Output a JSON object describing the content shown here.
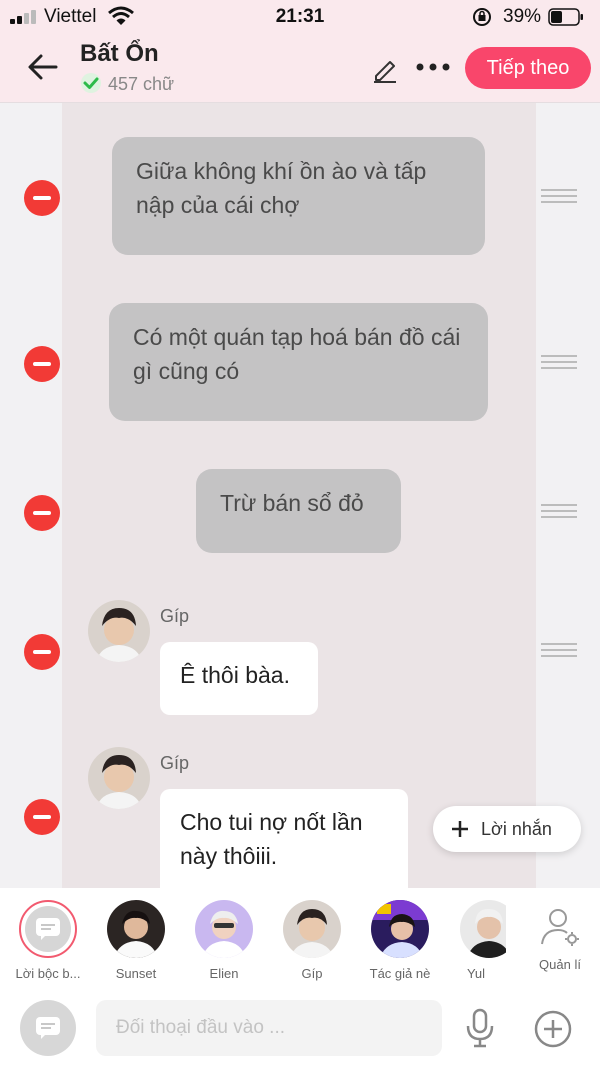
{
  "status_bar": {
    "carrier": "Viettel",
    "time": "21:31",
    "battery": "39%"
  },
  "header": {
    "title": "Bất Ổn",
    "word_count": "457 chữ",
    "next_label": "Tiếp theo"
  },
  "messages": [
    {
      "type": "narration",
      "text": "Giữa không khí ồn ào và tấp nập của cái chợ"
    },
    {
      "type": "narration",
      "text": "Có một quán tạp hoá bán đồ cái gì cũng có"
    },
    {
      "type": "narration",
      "text": "Trừ bán sổ đỏ"
    },
    {
      "type": "dialogue",
      "speaker": "Gíp",
      "text": "Ê thôi bàa."
    },
    {
      "type": "dialogue",
      "speaker": "Gíp",
      "text": "Cho tui nợ nốt lần này thôiii."
    }
  ],
  "add_line_label": "Lời nhắn",
  "characters": [
    {
      "name": "Lời bộc b...",
      "selected": true
    },
    {
      "name": "Sunset"
    },
    {
      "name": "Elien"
    },
    {
      "name": "Gíp"
    },
    {
      "name": "Tác giả nè"
    },
    {
      "name": "Yul"
    }
  ],
  "manage_label": "Quản lí",
  "composer": {
    "placeholder": "Đối thoại đầu vào ..."
  },
  "colors": {
    "accent": "#f9466b",
    "delete": "#f23a36",
    "header_bg": "#fae9ed",
    "narration_bg": "#c4c3c4"
  }
}
